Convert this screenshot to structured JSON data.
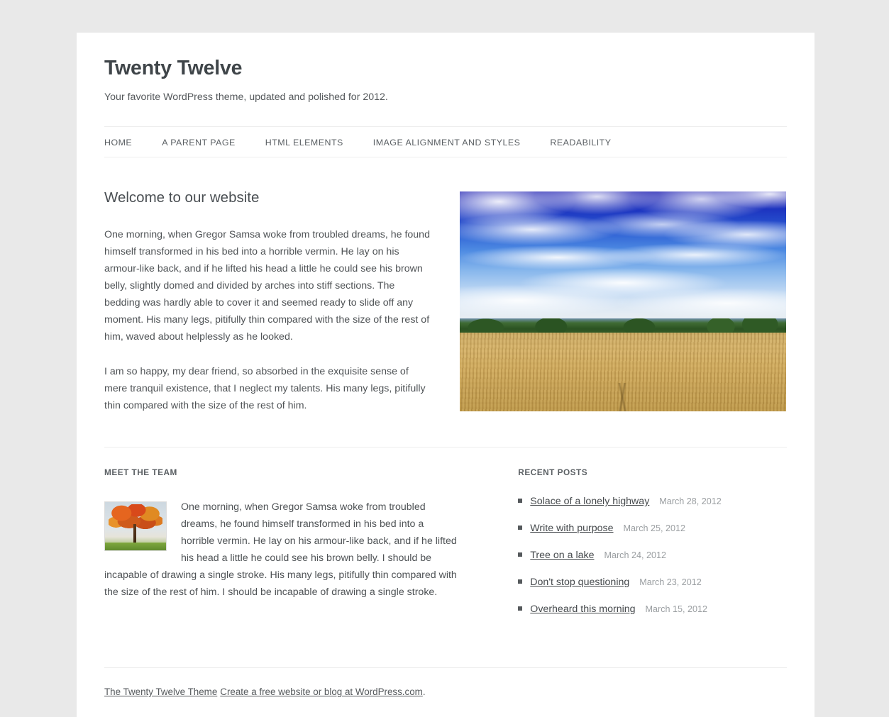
{
  "site": {
    "title": "Twenty Twelve",
    "description": "Your favorite WordPress theme, updated and polished for 2012."
  },
  "nav": {
    "items": [
      {
        "label": "Home"
      },
      {
        "label": "A Parent Page"
      },
      {
        "label": "HTML Elements"
      },
      {
        "label": "Image Alignment and Styles"
      },
      {
        "label": "Readability"
      }
    ]
  },
  "main": {
    "heading": "Welcome to our website",
    "paragraph1": "One morning, when Gregor Samsa woke from troubled dreams, he found himself transformed in his bed into a horrible vermin. He lay on his armour-like back, and if he lifted his head a little he could see his brown belly, slightly domed and divided by arches into stiff sections. The bedding was hardly able to cover it and seemed ready to slide off any moment. His many legs, pitifully thin compared with the size of the rest of him, waved about helplessly as he looked.",
    "paragraph2": "I am so happy, my dear friend, so absorbed in the exquisite sense of mere tranquil existence, that I neglect my talents. His many legs, pitifully thin compared with the size of the rest of him.",
    "hero_image_alt": "Golden wheat field under a deep blue sky with white clouds and a green tree line"
  },
  "team_widget": {
    "title": "Meet the Team",
    "body": "One morning, when Gregor Samsa woke from troubled dreams, he found himself transformed in his bed into a horrible vermin. He lay on his armour-like back, and if he lifted his head a little he could see his brown belly. I should be incapable of drawing a single stroke. His many legs, pitifully thin compared with the size of the rest of him. I should be incapable of drawing a single stroke.",
    "thumbnail_alt": "Watercolor painting of an autumn tree with orange foliage"
  },
  "recent_posts": {
    "title": "Recent Posts",
    "items": [
      {
        "title": "Solace of a lonely highway",
        "date": "March 28, 2012"
      },
      {
        "title": "Write with purpose",
        "date": "March 25, 2012"
      },
      {
        "title": "Tree on a lake",
        "date": "March 24, 2012"
      },
      {
        "title": "Don't stop questioning",
        "date": "March 23, 2012"
      },
      {
        "title": "Overheard this morning",
        "date": "March 15, 2012"
      }
    ]
  },
  "footer": {
    "theme_link": "The Twenty Twelve Theme",
    "wordpress_link": "Create a free website or blog at WordPress.com",
    "period": "."
  },
  "colors": {
    "page_background": "#e9e9e9",
    "content_background": "#ffffff",
    "heading_text": "#4a4f53",
    "body_text": "#4f5356",
    "muted_text": "#9a9ea1",
    "divider": "#ededed"
  }
}
